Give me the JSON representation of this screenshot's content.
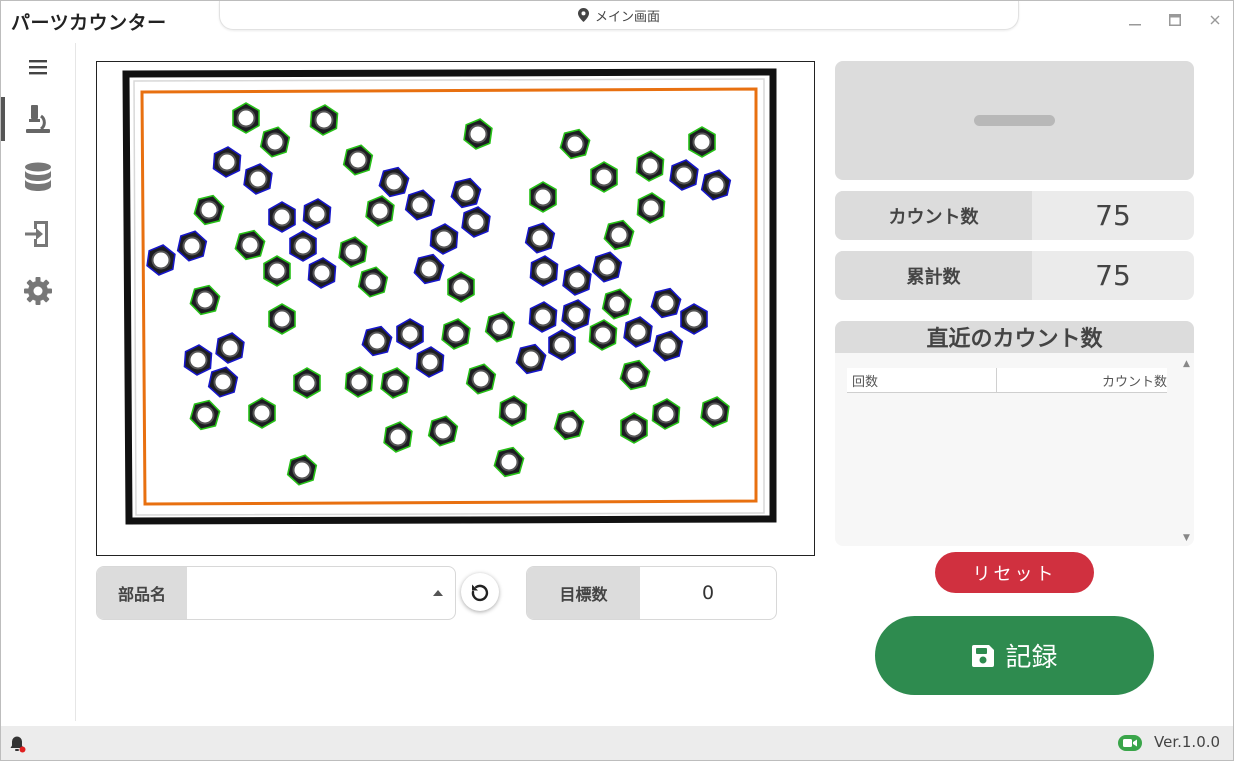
{
  "app": {
    "title": "パーツカウンター",
    "location": "メイン画面"
  },
  "window_controls": {
    "minimize": "—",
    "maximize": "▬",
    "close": "✕"
  },
  "sidebar": {
    "items": [
      {
        "icon": "menu-icon"
      },
      {
        "icon": "microscope-icon",
        "active": true
      },
      {
        "icon": "database-icon"
      },
      {
        "icon": "import-icon"
      },
      {
        "icon": "gear-icon"
      }
    ]
  },
  "controls": {
    "part_name_label": "部品名",
    "part_name_value": "",
    "target_label": "目標数",
    "target_value": "0"
  },
  "stats": {
    "count_label": "カウント数",
    "count_value": "75",
    "total_label": "累計数",
    "total_value": "75"
  },
  "recent": {
    "title": "直近のカウント数",
    "col_times": "回数",
    "col_count": "カウント数",
    "rows": []
  },
  "buttons": {
    "reset": "リセット",
    "record": "記録"
  },
  "status": {
    "version": "Ver.1.0.0"
  },
  "colors": {
    "accent_red": "#d0303f",
    "accent_green": "#2e8b4f",
    "detect_green": "#27c018",
    "detect_blue": "#1717c8",
    "roi_orange": "#e87010"
  }
}
